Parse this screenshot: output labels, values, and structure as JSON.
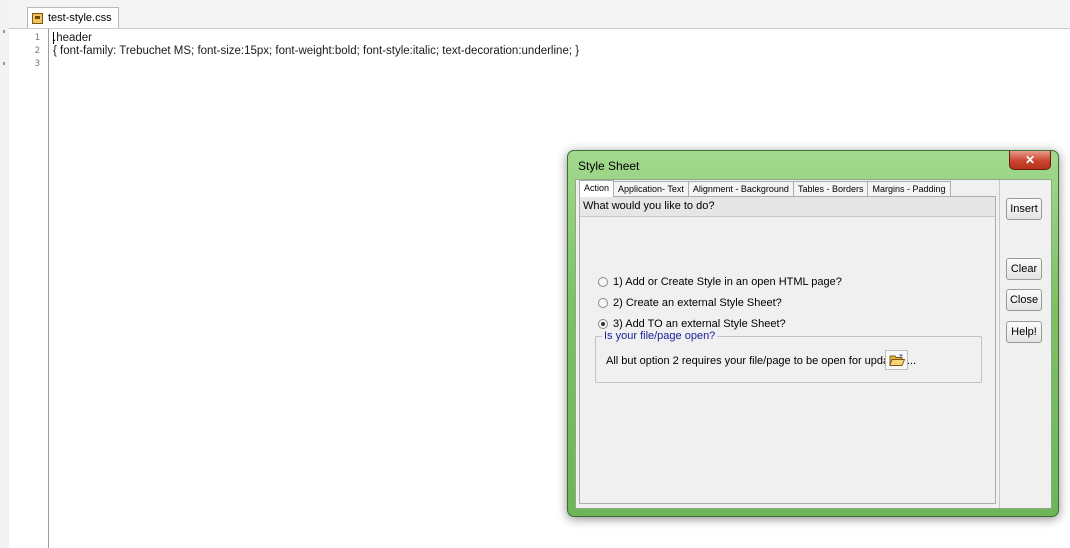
{
  "editor": {
    "file_tab": "test-style.css",
    "line_numbers": [
      "1",
      "2",
      "3"
    ],
    "lines": [
      ".header",
      "{ font-family: Trebuchet MS; font-size:15px; font-weight:bold; font-style:italic; text-decoration:underline; }",
      ""
    ]
  },
  "dialog": {
    "title": "Style Sheet",
    "close_glyph": "✕",
    "tabs": [
      {
        "label": "Action",
        "active": true
      },
      {
        "label": "Application- Text"
      },
      {
        "label": "Alignment - Background"
      },
      {
        "label": "Tables - Borders"
      },
      {
        "label": "Margins - Padding"
      }
    ],
    "question": "What would you like to do?",
    "options": [
      {
        "label": "1) Add or Create Style in an open HTML page?",
        "checked": false
      },
      {
        "label": "2) Create an external Style Sheet?",
        "checked": false
      },
      {
        "label": "3) Add TO an external Style Sheet?",
        "checked": true
      }
    ],
    "group": {
      "legend": "Is your file/page open?",
      "text": "All but option 2 requires your file/page to be open for updating..."
    },
    "buttons": {
      "insert": "Insert",
      "clear": "Clear",
      "close": "Close",
      "help": "Help!"
    }
  },
  "colors": {
    "dialog_frame": "#7cc366",
    "close_button": "#c9452f",
    "legend_text": "#1c1c9a"
  }
}
